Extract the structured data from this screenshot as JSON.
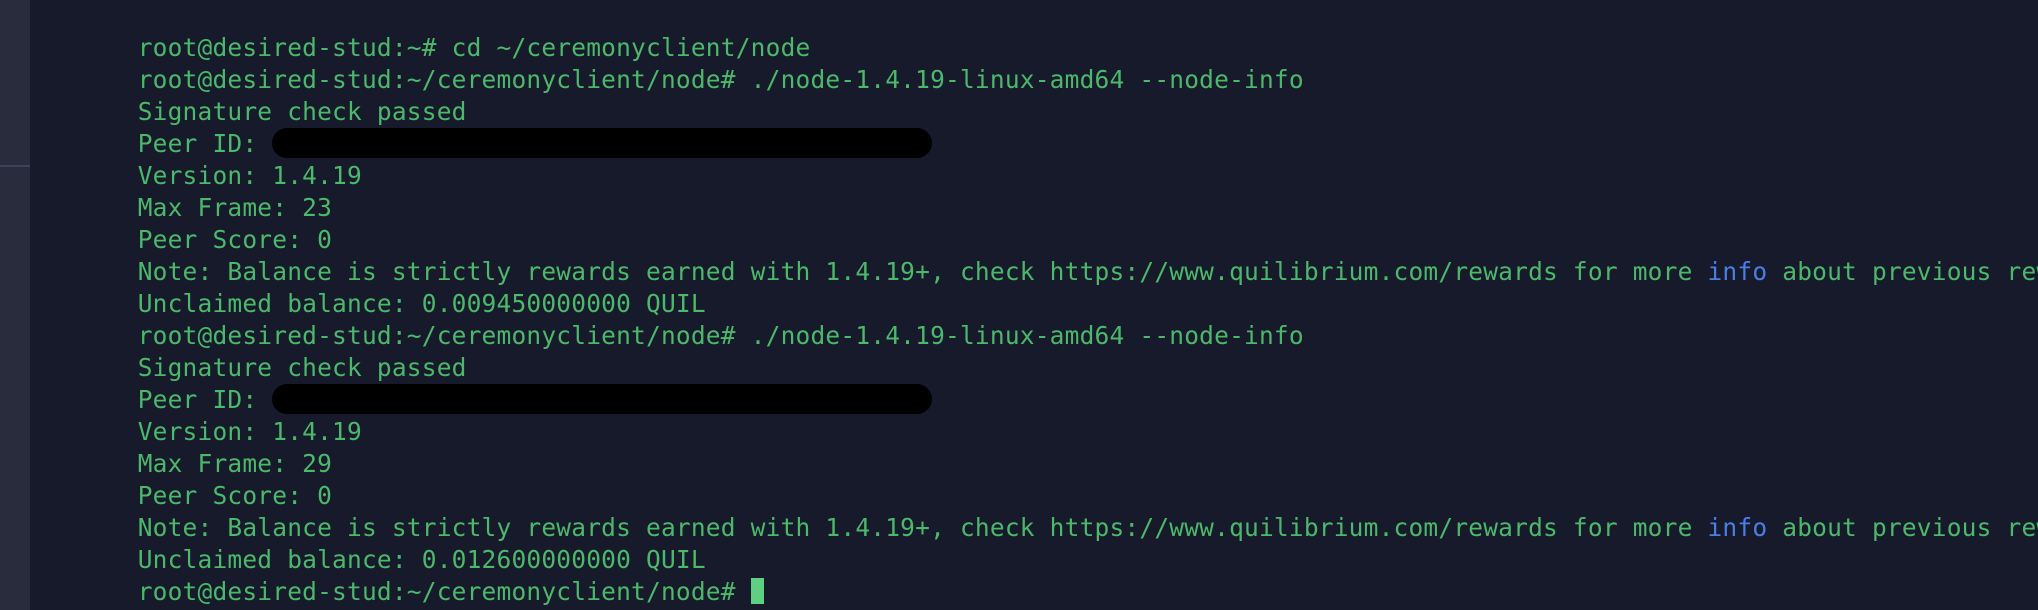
{
  "window": {
    "type": "terminal-console",
    "background_color": "#171a2b",
    "gutter_color": "#292c3c",
    "gutter_divider_color": "#3d415a",
    "text_color": "#4cb86a",
    "link_color": "#4a7de8",
    "redaction_color": "#000000",
    "cursor_color": "#5fcf84"
  },
  "prompts": {
    "home": "root@desired-stud:~#",
    "node_dir": "root@desired-stud:~/ceremonyclient/node#"
  },
  "commands": {
    "cd": "cd ~/ceremonyclient/node",
    "node_info": "./node-1.4.19-linux-amd64 --node-info"
  },
  "lines": [
    {
      "id": "line-1-cd-command",
      "kind": "command",
      "text": "root@desired-stud:~# cd ~/ceremonyclient/node"
    },
    {
      "id": "line-2-node-info-command-1",
      "kind": "command",
      "text": "root@desired-stud:~/ceremonyclient/node# ./node-1.4.19-linux-amd64 --node-info"
    },
    {
      "id": "line-3-signature-1",
      "kind": "output",
      "text": "Signature check passed"
    },
    {
      "id": "line-4-peer-id-1",
      "kind": "output-redacted",
      "label": "Peer ID: ",
      "redacted": true
    },
    {
      "id": "line-5-version-1",
      "kind": "output",
      "text": "Version: 1.4.19"
    },
    {
      "id": "line-6-max-frame-1",
      "kind": "output",
      "text": "Max Frame: 23"
    },
    {
      "id": "line-7-peer-score-1",
      "kind": "output",
      "text": "Peer Score: 0"
    },
    {
      "id": "line-8-note-1",
      "kind": "output-link",
      "pre": "Note: Balance is strictly rewards earned with 1.4.19+, check https://www.quilibrium.com/rewards for more ",
      "link": "info",
      "post": " about previous rewards."
    },
    {
      "id": "line-9-unclaimed-1",
      "kind": "output",
      "text": "Unclaimed balance: 0.009450000000 QUIL"
    },
    {
      "id": "line-10-node-info-command-2",
      "kind": "command",
      "text": "root@desired-stud:~/ceremonyclient/node# ./node-1.4.19-linux-amd64 --node-info"
    },
    {
      "id": "line-11-signature-2",
      "kind": "output",
      "text": "Signature check passed"
    },
    {
      "id": "line-12-peer-id-2",
      "kind": "output-redacted",
      "label": "Peer ID: ",
      "redacted": true
    },
    {
      "id": "line-13-version-2",
      "kind": "output",
      "text": "Version: 1.4.19"
    },
    {
      "id": "line-14-max-frame-2",
      "kind": "output",
      "text": "Max Frame: 29"
    },
    {
      "id": "line-15-peer-score-2",
      "kind": "output",
      "text": "Peer Score: 0"
    },
    {
      "id": "line-16-note-2",
      "kind": "output-link",
      "pre": "Note: Balance is strictly rewards earned with 1.4.19+, check https://www.quilibrium.com/rewards for more ",
      "link": "info",
      "post": " about previous rewards."
    },
    {
      "id": "line-17-unclaimed-2",
      "kind": "output",
      "text": "Unclaimed balance: 0.012600000000 QUIL"
    },
    {
      "id": "line-18-prompt-cursor",
      "kind": "prompt-cursor",
      "text": "root@desired-stud:~/ceremonyclient/node# "
    }
  ],
  "node_report_1": {
    "signature": "Signature check passed",
    "peer_id_label": "Peer ID:",
    "peer_id_value": "",
    "version": "1.4.19",
    "max_frame": "23",
    "peer_score": "0",
    "unclaimed_balance": "0.009450000000",
    "currency": "QUIL"
  },
  "node_report_2": {
    "signature": "Signature check passed",
    "peer_id_label": "Peer ID:",
    "peer_id_value": "",
    "version": "1.4.19",
    "max_frame": "29",
    "peer_score": "0",
    "unclaimed_balance": "0.012600000000",
    "currency": "QUIL"
  }
}
